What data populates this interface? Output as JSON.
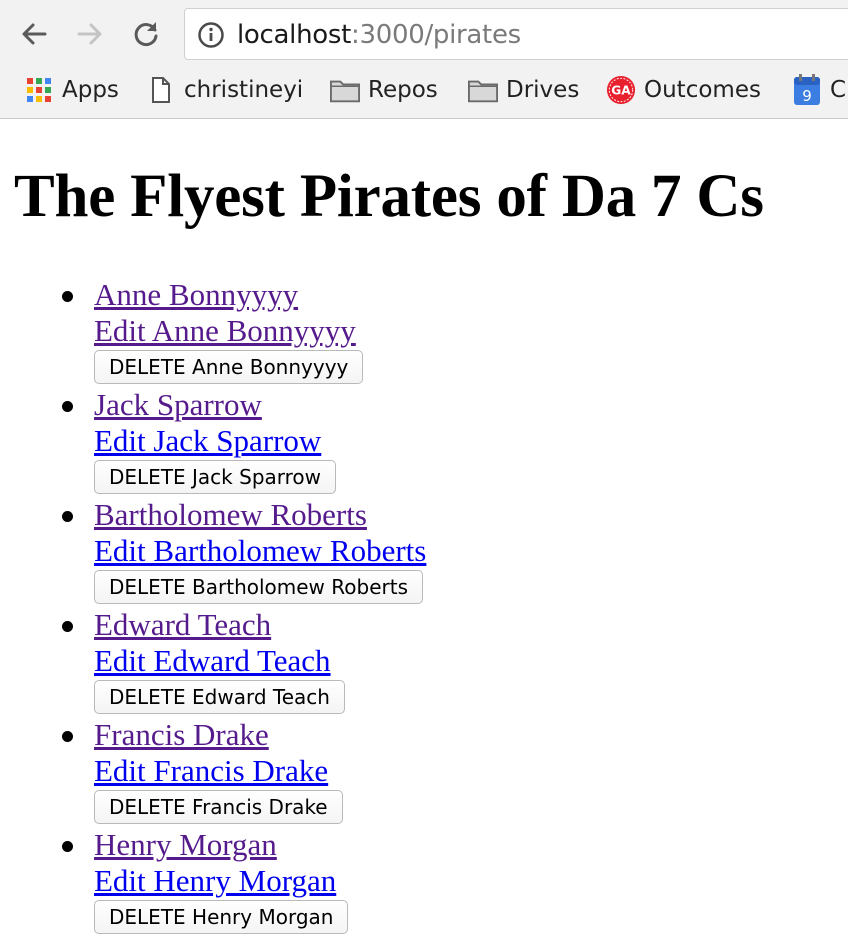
{
  "browser": {
    "url_host": "localhost",
    "url_path": ":3000/pirates",
    "bookmarks": [
      {
        "label": "Apps",
        "icon": "apps-grid-icon"
      },
      {
        "label": "christineyi",
        "icon": "page-icon"
      },
      {
        "label": "Repos",
        "icon": "folder-icon"
      },
      {
        "label": "Drives",
        "icon": "folder-icon"
      },
      {
        "label": "Outcomes",
        "icon": "ga-logo-icon",
        "icon_text": "GA"
      },
      {
        "label": "C",
        "icon": "calendar-icon",
        "icon_text": "9"
      }
    ]
  },
  "page": {
    "title": "The Flyest Pirates of Da 7 Cs",
    "pirates": [
      {
        "name": "Anne Bonnyyyy",
        "edit": "Edit Anne Bonnyyyy",
        "delete": "DELETE Anne Bonnyyyy",
        "edit_visited": true
      },
      {
        "name": "Jack Sparrow",
        "edit": "Edit Jack Sparrow",
        "delete": "DELETE Jack Sparrow",
        "edit_visited": false
      },
      {
        "name": "Bartholomew Roberts",
        "edit": "Edit Bartholomew Roberts",
        "delete": "DELETE Bartholomew Roberts",
        "edit_visited": false
      },
      {
        "name": "Edward Teach",
        "edit": "Edit Edward Teach",
        "delete": "DELETE Edward Teach",
        "edit_visited": false
      },
      {
        "name": "Francis Drake",
        "edit": "Edit Francis Drake",
        "delete": "DELETE Francis Drake",
        "edit_visited": false
      },
      {
        "name": "Henry Morgan",
        "edit": "Edit Henry Morgan",
        "delete": "DELETE Henry Morgan",
        "edit_visited": false
      }
    ]
  },
  "colors": {
    "visited_link": "#551a8b",
    "unvisited_link": "#0000ee",
    "ga_red": "#e8212e",
    "calendar_blue": "#3b7de0"
  }
}
